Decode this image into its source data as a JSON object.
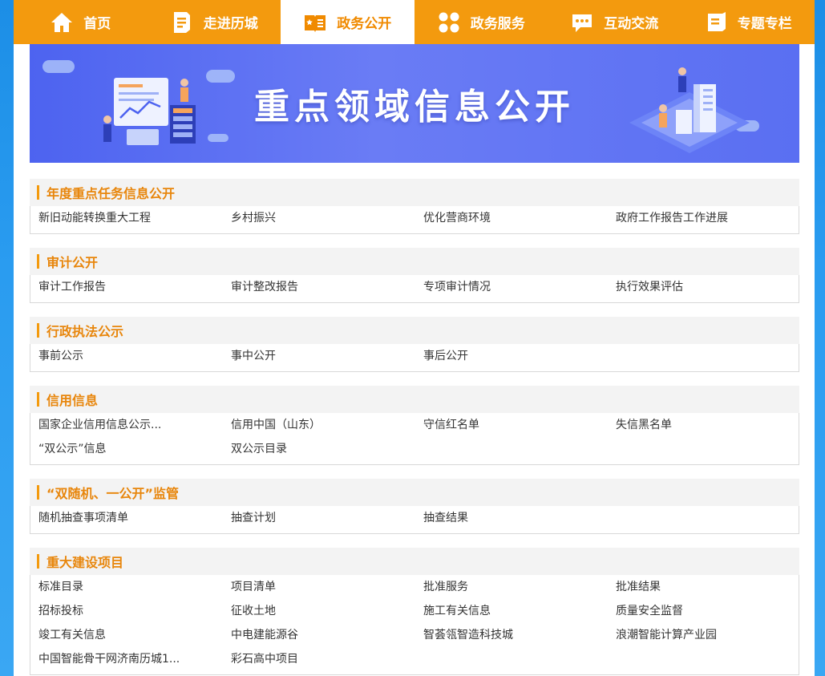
{
  "nav": {
    "items": [
      {
        "label": "首页",
        "icon": "home-icon",
        "active": false
      },
      {
        "label": "走进历城",
        "icon": "document-icon",
        "active": false
      },
      {
        "label": "政务公开",
        "icon": "book-icon",
        "active": true
      },
      {
        "label": "政务服务",
        "icon": "grid-icon",
        "active": false
      },
      {
        "label": "互动交流",
        "icon": "chat-icon",
        "active": false
      },
      {
        "label": "专题专栏",
        "icon": "notebook-icon",
        "active": false
      }
    ]
  },
  "banner": {
    "title": "重点领域信息公开"
  },
  "sections": [
    {
      "title": "年度重点任务信息公开",
      "links": [
        "新旧动能转换重大工程",
        "乡村振兴",
        "优化营商环境",
        "政府工作报告工作进展"
      ]
    },
    {
      "title": "审计公开",
      "links": [
        "审计工作报告",
        "审计整改报告",
        "专项审计情况",
        "执行效果评估"
      ]
    },
    {
      "title": "行政执法公示",
      "links": [
        "事前公示",
        "事中公开",
        "事后公开"
      ]
    },
    {
      "title": "信用信息",
      "links": [
        "国家企业信用信息公示...",
        "信用中国（山东）",
        "守信红名单",
        "失信黑名单",
        "“双公示”信息",
        "双公示目录"
      ]
    },
    {
      "title": "“双随机、一公开”监管",
      "links": [
        "随机抽查事项清单",
        "抽查计划",
        "抽查结果"
      ]
    },
    {
      "title": "重大建设项目",
      "links": [
        "标准目录",
        "项目清单",
        "批准服务",
        "批准结果",
        "招标投标",
        "征收土地",
        "施工有关信息",
        "质量安全监督",
        "竣工有关信息",
        "中电建能源谷",
        "智荟瓴智造科技城",
        "浪潮智能计算产业园",
        "中国智能骨干网济南历城1...",
        "彩石高中项目"
      ]
    }
  ],
  "colors": {
    "accent": "#f39a0e",
    "section_title": "#e8860c",
    "banner": "#5a6ff2"
  }
}
